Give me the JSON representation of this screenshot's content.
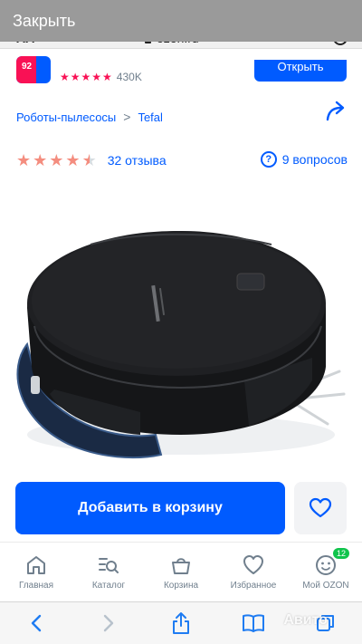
{
  "overlay": {
    "close_label": "Закрыть"
  },
  "address_bar": {
    "aa_label": "AA",
    "url": "ozon.ru"
  },
  "seller": {
    "badge": "92",
    "stars": "★★★★★",
    "count": "430K",
    "subscribe_label": "Открыть"
  },
  "breadcrumbs": {
    "category": "Роботы-пылесосы",
    "separator": ">",
    "brand": "Tefal"
  },
  "rating": {
    "value": 4.5,
    "reviews_label": "32 отзыва",
    "questions_label": "9 вопросов",
    "question_mark": "?"
  },
  "product": {
    "image_icon": "robot-vacuum-image",
    "colors": {
      "body": "#1b1c1e",
      "dock": "#1a2a44",
      "accent": "#f91155"
    }
  },
  "actions": {
    "add_to_cart_label": "Добавить в корзину"
  },
  "tabbar": {
    "items": [
      {
        "label": "Главная",
        "icon": "home-icon"
      },
      {
        "label": "Каталог",
        "icon": "catalog-icon"
      },
      {
        "label": "Корзина",
        "icon": "basket-icon"
      },
      {
        "label": "Избранное",
        "icon": "heart-icon"
      },
      {
        "label": "Мой OZON",
        "icon": "profile-icon",
        "badge": "12"
      }
    ]
  },
  "safari_toolbar": {
    "watermark": "Авито"
  },
  "colors": {
    "brand_blue": "#005bff",
    "star": "#f48d7f",
    "badge_green": "#10c44c"
  }
}
